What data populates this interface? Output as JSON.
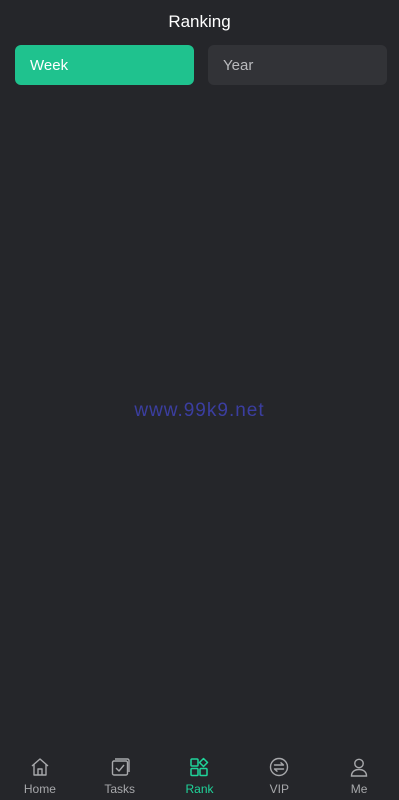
{
  "header": {
    "title": "Ranking"
  },
  "tabs": [
    {
      "label": "Week",
      "active": true
    },
    {
      "label": "Year",
      "active": false
    }
  ],
  "watermark": "www.99k9.net",
  "colors": {
    "background": "#25262a",
    "accent": "#1fc28e",
    "tab_inactive": "#323337",
    "nav_inactive": "#a7a8ab",
    "nav_active": "#1fd49a",
    "watermark": "#3b3ea0"
  },
  "bottom_nav": {
    "items": [
      {
        "label": "Home",
        "icon": "home-icon",
        "active": false
      },
      {
        "label": "Tasks",
        "icon": "tasks-icon",
        "active": false
      },
      {
        "label": "Rank",
        "icon": "rank-icon",
        "active": true
      },
      {
        "label": "VIP",
        "icon": "vip-icon",
        "active": false
      },
      {
        "label": "Me",
        "icon": "profile-icon",
        "active": false
      }
    ]
  }
}
